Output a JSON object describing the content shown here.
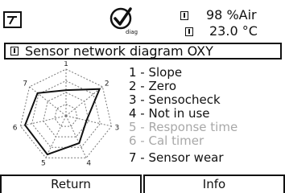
{
  "header": {
    "menu_icon": "menu-icon",
    "diag_icon": "diag-checkmark-icon",
    "diag_label": "diag",
    "air_value": "98 %Air",
    "temp_value": "23.0 °C"
  },
  "title": "Sensor network diagram  OXY",
  "radar": {
    "axis_labels": [
      "1",
      "2",
      "3",
      "4",
      "5",
      "6",
      "7"
    ],
    "values": [
      0.55,
      0.92,
      0.45,
      0.65,
      0.92,
      0.9,
      0.78
    ],
    "rings": [
      0.25,
      0.5,
      0.75,
      1.0
    ]
  },
  "legend": [
    {
      "text": "1 - Slope",
      "dim": false
    },
    {
      "text": "2 - Zero",
      "dim": false
    },
    {
      "text": "3 - Sensocheck",
      "dim": false
    },
    {
      "text": "4 - Not in use",
      "dim": false
    },
    {
      "text": "5 - Response time",
      "dim": true
    },
    {
      "text": "6 - Cal timer",
      "dim": true
    },
    {
      "text": "7 - Sensor wear",
      "dim": false
    }
  ],
  "buttons": {
    "return_label": "Return",
    "info_label": "Info"
  },
  "colors": {
    "text": "#111111",
    "dim_text": "#a8a8a8",
    "background": "#ffffff"
  }
}
